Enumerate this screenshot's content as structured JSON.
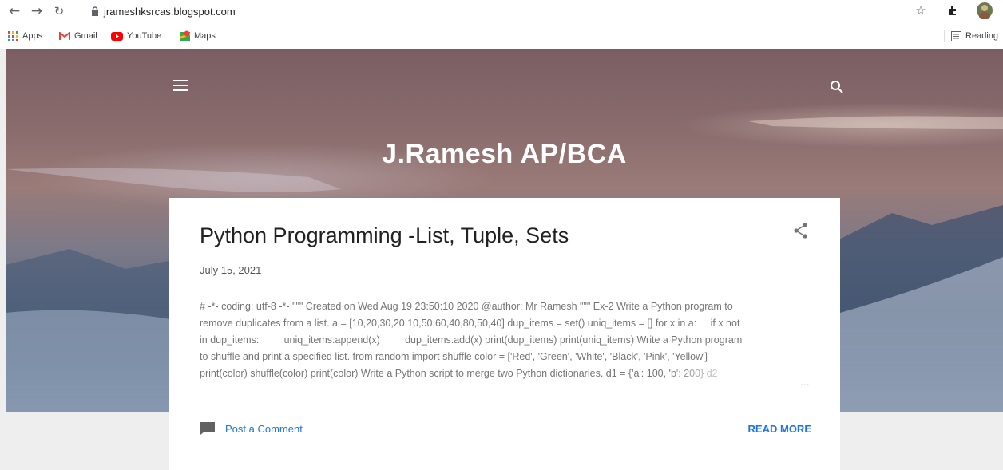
{
  "browser": {
    "url": "jrameshksrcas.blogspot.com",
    "bookmarks": [
      {
        "label": "Apps",
        "icon": "apps-grid-icon"
      },
      {
        "label": "Gmail",
        "icon": "gmail-icon"
      },
      {
        "label": "YouTube",
        "icon": "youtube-icon"
      },
      {
        "label": "Maps",
        "icon": "maps-icon"
      }
    ],
    "reading_list_label": "Reading"
  },
  "blog": {
    "title": "J.Ramesh AP/BCA"
  },
  "post": {
    "title": "Python Programming -List, Tuple, Sets",
    "date": "July 15, 2021",
    "snippet_lines": [
      "# -*- coding: utf-8 -*- \"\"\" Created on Wed Aug 19 23:50:10 2020 @author: Mr Ramesh \"\"\" Ex-2 Write a Python program to",
      "remove duplicates from a list. a = [10,20,30,20,10,50,60,40,80,50,40] dup_items = set() uniq_items = [] for x in a:     if x not",
      "in dup_items:         uniq_items.append(x)         dup_items.add(x) print(dup_items) print(uniq_items) Write a Python program",
      "to shuffle and print a specified list. from random import shuffle color = ['Red', 'Green', 'White', 'Black', 'Pink', 'Yellow']",
      "print(color) shuffle(color) print(color) Write a Python script to merge two Python dictionaries. d1 = {'a': 100, 'b': 200} d2"
    ],
    "ellipsis": "…",
    "comment_label": "Post a Comment",
    "read_more_label": "READ MORE"
  },
  "colors": {
    "link": "#1a73e8",
    "page_bg": "#eeeeee"
  }
}
